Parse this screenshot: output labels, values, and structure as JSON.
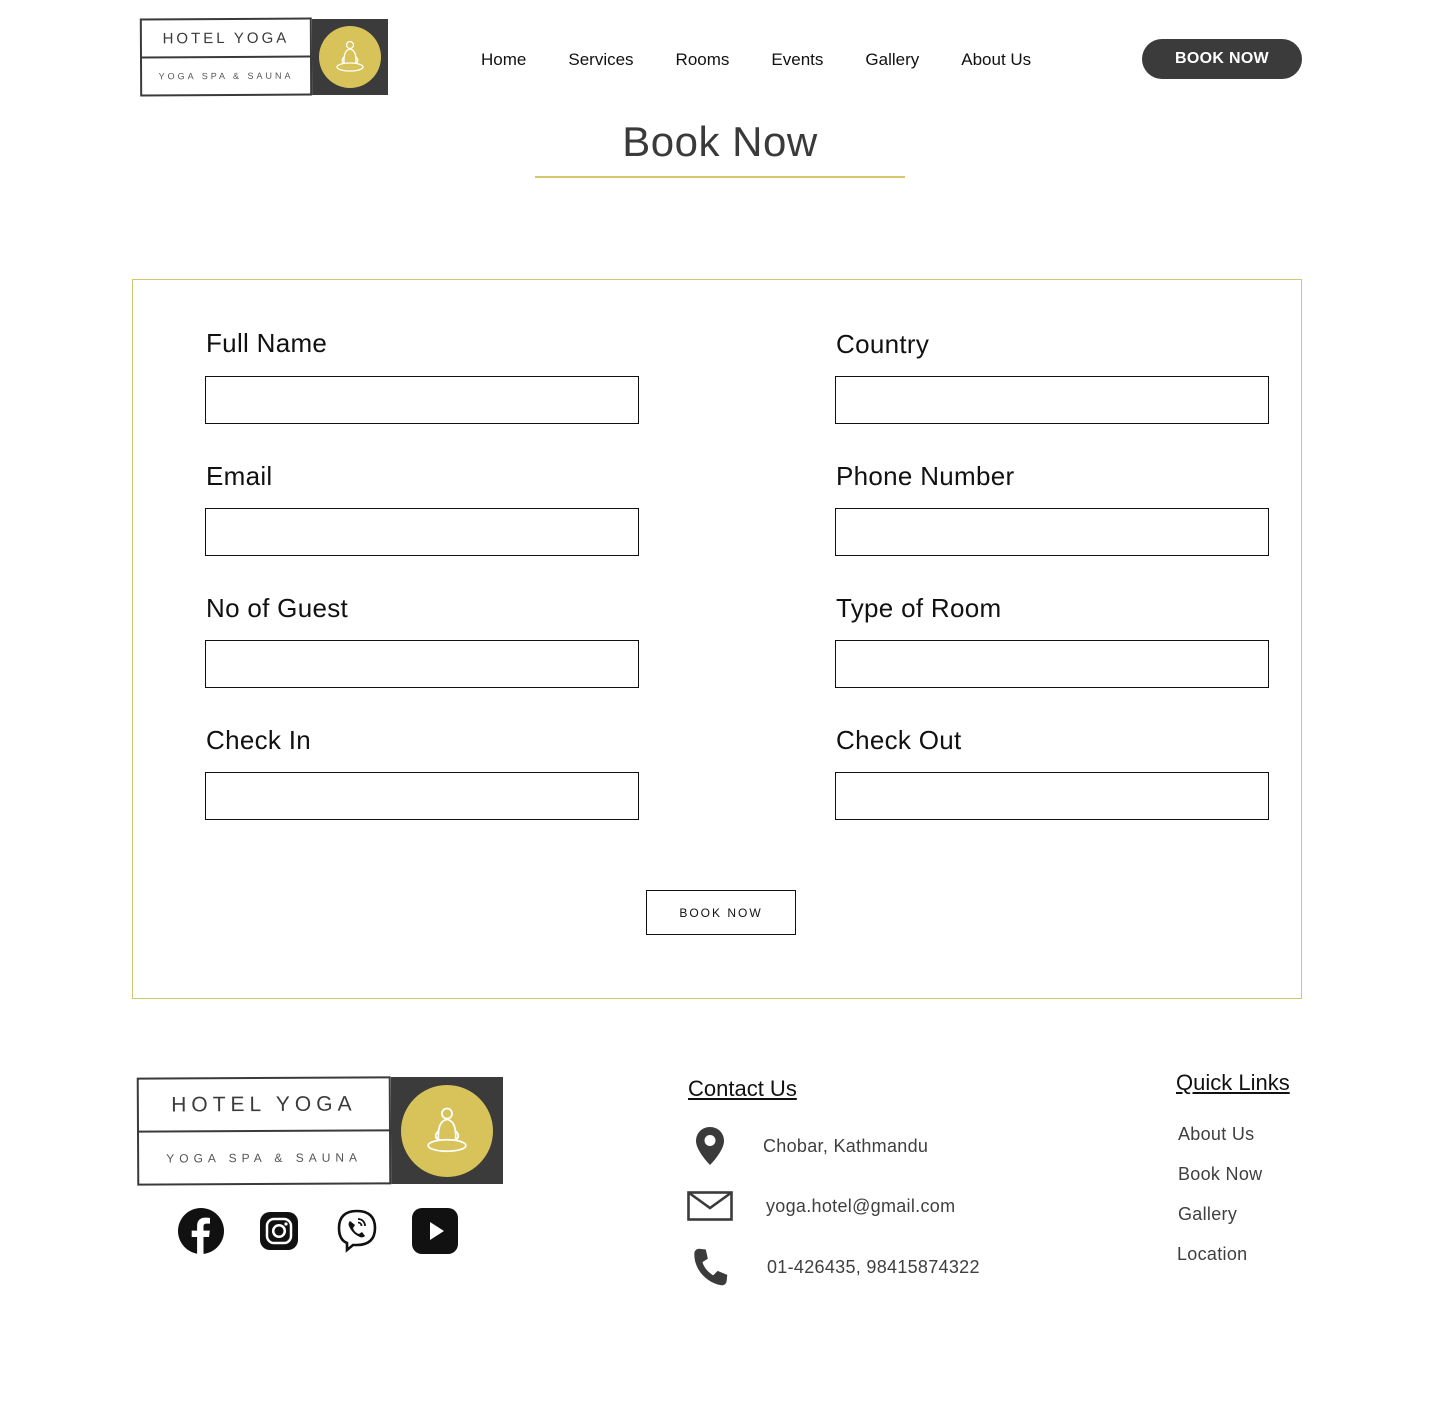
{
  "brand": {
    "name": "HOTEL YOGA",
    "tagline": "YOGA SPA & SAUNA",
    "accent_color": "#d7c35a",
    "dark_color": "#3b3b3b"
  },
  "nav": {
    "items": [
      {
        "label": "Home"
      },
      {
        "label": "Services"
      },
      {
        "label": "Rooms"
      },
      {
        "label": "Events"
      },
      {
        "label": "Gallery"
      },
      {
        "label": "About Us"
      }
    ],
    "cta_label": "BOOK NOW"
  },
  "page": {
    "title": "Book Now"
  },
  "form": {
    "full_name_label": "Full Name",
    "country_label": "Country",
    "email_label": "Email",
    "phone_label": "Phone Number",
    "guests_label": "No of Guest",
    "room_type_label": "Type of Room",
    "check_in_label": "Check In",
    "check_out_label": "Check Out",
    "submit_label": "BOOK NOW"
  },
  "footer": {
    "socials": [
      {
        "icon": "facebook-icon"
      },
      {
        "icon": "instagram-icon"
      },
      {
        "icon": "viber-icon"
      },
      {
        "icon": "youtube-icon"
      }
    ],
    "contact": {
      "heading": "Contact Us",
      "address": "Chobar, Kathmandu",
      "email": "yoga.hotel@gmail.com",
      "phone": "01-426435, 98415874322"
    },
    "quick_links": {
      "heading": "Quick Links",
      "items": [
        {
          "label": "About Us"
        },
        {
          "label": "Book Now"
        },
        {
          "label": "Gallery"
        },
        {
          "label": "Location"
        }
      ]
    }
  }
}
